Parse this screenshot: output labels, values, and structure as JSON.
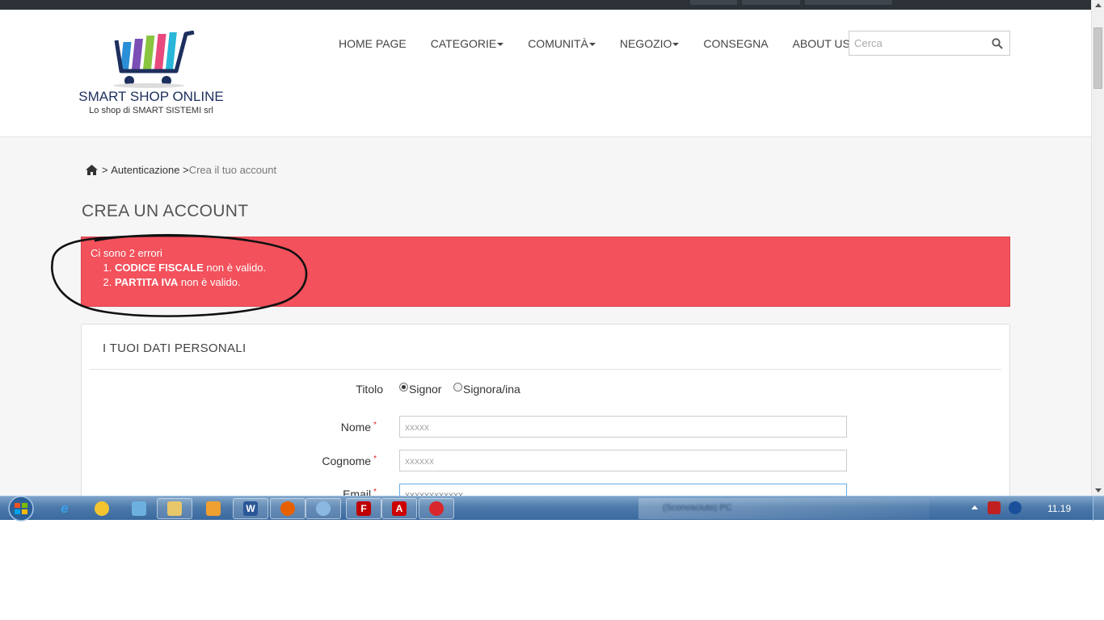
{
  "logo": {
    "title": "SMART SHOP ONLINE",
    "subtitle": "Lo shop di SMART SISTEMI srl"
  },
  "nav": {
    "items": [
      {
        "label": "HOME PAGE",
        "dropdown": false
      },
      {
        "label": "CATEGORIE",
        "dropdown": true
      },
      {
        "label": "COMUNITÀ",
        "dropdown": true
      },
      {
        "label": "NEGOZIO",
        "dropdown": true
      },
      {
        "label": "CONSEGNA",
        "dropdown": false
      },
      {
        "label": "ABOUT US",
        "dropdown": false
      }
    ]
  },
  "search": {
    "placeholder": "Cerca"
  },
  "breadcrumb": {
    "sep1": ">",
    "item1": "Autenticazione",
    "sep2": ">",
    "current": "Crea il tuo account"
  },
  "page": {
    "title": "CREA UN ACCOUNT"
  },
  "alert": {
    "heading": "Ci sono 2 errori",
    "errors": [
      {
        "field": "CODICE FISCALE",
        "message": "non è valido."
      },
      {
        "field": "PARTITA IVA",
        "message": "non è valido."
      }
    ]
  },
  "form": {
    "section_title": "I TUOI DATI PERSONALI",
    "title_label": "Titolo",
    "title_options": [
      {
        "label": "Signor",
        "checked": true
      },
      {
        "label": "Signora/ina",
        "checked": false
      }
    ],
    "fields": [
      {
        "label": "Nome",
        "required": true,
        "value": "xxxxx"
      },
      {
        "label": "Cognome",
        "required": true,
        "value": "xxxxxx"
      },
      {
        "label": "Email",
        "required": true,
        "value": "xxxxxxxxxxxx"
      }
    ]
  },
  "taskbar": {
    "clock": "11.19",
    "blurred_window": "(Sconosciuto) PC"
  },
  "colors": {
    "alert_bg": "#f3515c",
    "logo_text": "#1d2f5e",
    "taskbar": "#3a6aa0"
  }
}
